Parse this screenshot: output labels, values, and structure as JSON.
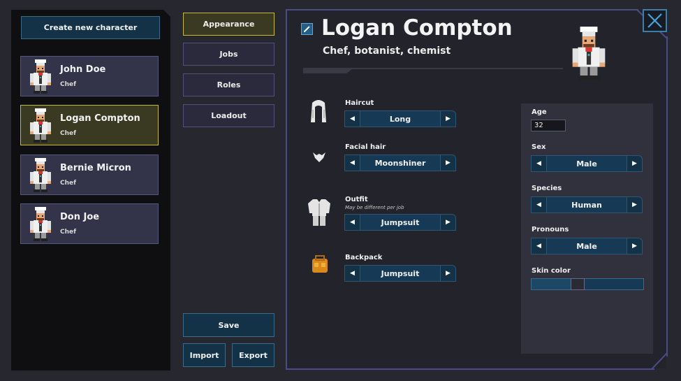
{
  "sidebar": {
    "create_button": "Create new character",
    "characters": [
      {
        "name": "John Doe",
        "job": "Chef",
        "selected": false
      },
      {
        "name": "Logan Compton",
        "job": "Chef",
        "selected": true
      },
      {
        "name": "Bernie Micron",
        "job": "Chef",
        "selected": false
      },
      {
        "name": "Don Joe",
        "job": "Chef",
        "selected": false
      }
    ]
  },
  "tabs": {
    "items": [
      "Appearance",
      "Jobs",
      "Roles",
      "Loadout"
    ],
    "active": "Appearance",
    "save_label": "Save",
    "import_label": "Import",
    "export_label": "Export"
  },
  "profile": {
    "name": "Logan Compton",
    "subtitle": "Chef, botanist, chemist"
  },
  "appearance": {
    "haircut": {
      "label": "Haircut",
      "value": "Long",
      "icon": "hair-icon"
    },
    "facial_hair": {
      "label": "Facial hair",
      "value": "Moonshiner",
      "icon": "beard-icon"
    },
    "outfit": {
      "label": "Outfit",
      "note": "May be different per job",
      "value": "Jumpsuit",
      "icon": "outfit-icon"
    },
    "backpack": {
      "label": "Backpack",
      "value": "Jumpsuit",
      "icon": "backpack-icon"
    }
  },
  "details": {
    "age_label": "Age",
    "age_value": "32",
    "sex_label": "Sex",
    "sex_value": "Male",
    "species_label": "Species",
    "species_value": "Human",
    "pronouns_label": "Pronouns",
    "pronouns_value": "Male",
    "skin_label": "Skin color",
    "skin_slider_fraction": 0.4
  },
  "colors": {
    "accent_blue": "#133247",
    "selected_yellow": "#c8b93a",
    "frame_purple": "#4b4b88"
  },
  "arrows": {
    "left": "◀",
    "right": "▶"
  }
}
